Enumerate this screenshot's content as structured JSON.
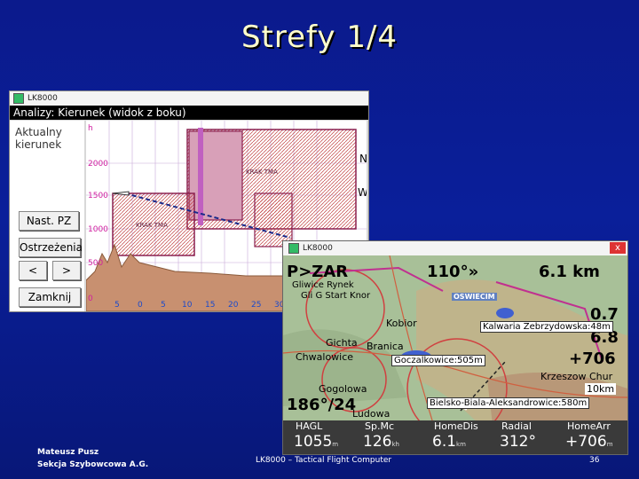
{
  "slide": {
    "title": "Strefy 1/4",
    "author": "Mateusz Pusz",
    "org": "Sekcja Szybowcowa A.G.",
    "footer_center": "LK8000 – Tactical Flight Computer",
    "page": "36"
  },
  "win1": {
    "app_title": "LK8000",
    "header": "Analizy: Kierunek (widok z boku)",
    "label": [
      "Aktualny",
      "kierunek"
    ],
    "buttons": {
      "nast_pz": "Nast. PZ",
      "ostrzezenia": "Ostrzeżenia",
      "prev": "<",
      "next": ">",
      "zamknij": "Zamknij"
    },
    "y_unit": "h",
    "y_ticks": [
      "2000",
      "1500",
      "1000",
      "500",
      "0"
    ],
    "x_ticks": [
      "5",
      "0",
      "5",
      "10",
      "15",
      "20",
      "25",
      "30"
    ],
    "compass": [
      "N",
      "W"
    ]
  },
  "win2": {
    "app_title": "LK8000",
    "close": "x",
    "target": "P>ZAR",
    "bearing": "110°»",
    "distance": "6.1 km",
    "track": "186°/24",
    "right_vals": [
      "0.7",
      "6.8",
      "+706"
    ],
    "scale": "10km",
    "place_labels": [
      "Gliwice Rynek",
      "Gli G Start Knor",
      "Kobior",
      "Gichta",
      "Branica",
      "Chwalowice",
      "Gogolowa",
      "Krzeszow Chur",
      "Ludowa",
      "OSWIECIM"
    ],
    "waypoint_boxes": [
      "Kalwaria Zebrzydowska:48m",
      "Goczalkowice:505m",
      "Bielsko-Biala-Aleksandrowice:580m"
    ],
    "info": [
      {
        "key": "HAGL",
        "val": "1055",
        "unit": "m"
      },
      {
        "key": "Sp.Mc",
        "val": "126",
        "unit": "kh"
      },
      {
        "key": "HomeDis",
        "val": "6.1",
        "unit": "km"
      },
      {
        "key": "Radial",
        "val": "312°",
        "unit": ""
      },
      {
        "key": "HomeArr",
        "val": "+706",
        "unit": "m"
      }
    ]
  }
}
